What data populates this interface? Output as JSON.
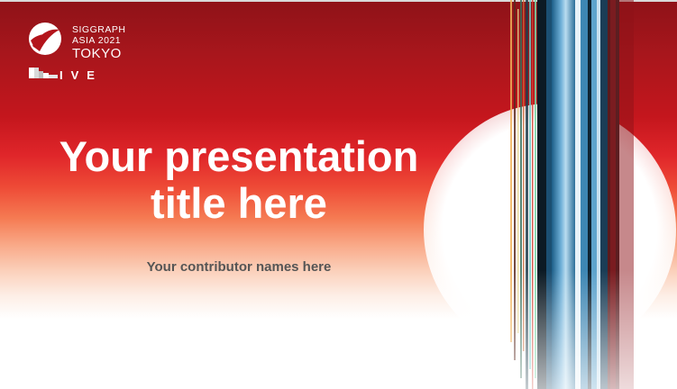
{
  "slide": {
    "logo": {
      "line1": "SIGGRAPH",
      "line2": "ASIA 2021",
      "line3": "TOKYO",
      "live": "IVE"
    },
    "title_line1": "Your presentation",
    "title_line2": "title here",
    "contributors": "Your contributor names here"
  },
  "colors": {
    "brand_red": "#c4161d",
    "dark_red": "#8e1218",
    "title_text": "#ffffff",
    "subtitle_text": "#555555"
  },
  "icons": {
    "logo": "siggraph-swirl-icon",
    "live_bars": "pixel-bar-icon"
  }
}
